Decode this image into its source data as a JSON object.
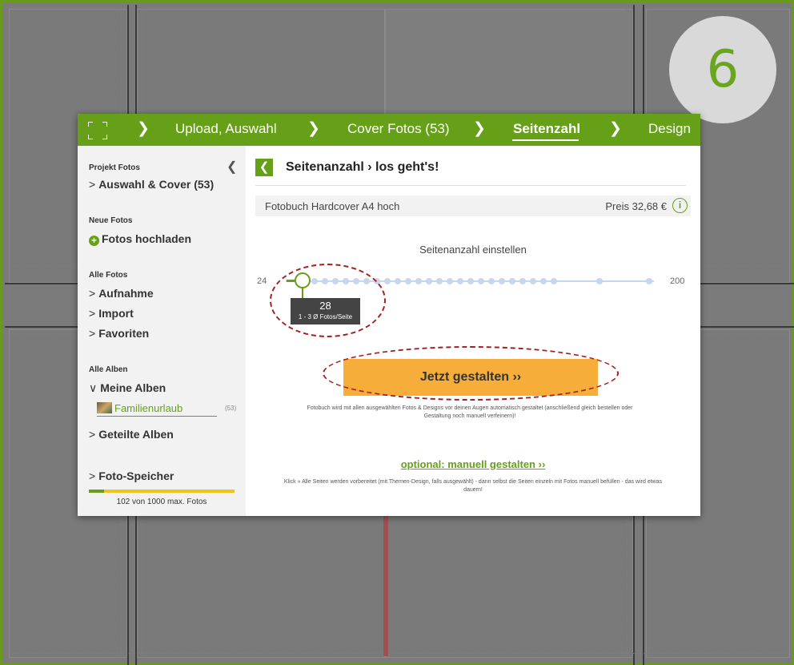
{
  "step_badge": "6",
  "nav": {
    "items": [
      "Upload, Auswahl",
      "Cover Fotos (53)",
      "Seitenzahl",
      "Design"
    ],
    "active": "Seitenzahl"
  },
  "sidebar": {
    "projekt_fotos": "Projekt Fotos",
    "auswahl_cover": "Auswahl & Cover (53)",
    "neue_fotos": "Neue Fotos",
    "fotos_hochladen": "Fotos hochladen",
    "alle_fotos": "Alle Fotos",
    "aufnahme": "Aufnahme",
    "import": "Import",
    "favoriten": "Favoriten",
    "alle_alben": "Alle Alben",
    "meine_alben": "Meine Alben",
    "album_name": "Familienurlaub",
    "album_count": "(53)",
    "geteilte_alben": "Geteilte Alben",
    "foto_speicher": "Foto-Speicher",
    "storage_used": 102,
    "storage_max": 1000,
    "storage_text": "102 von 1000 max. Fotos"
  },
  "main": {
    "title": "Seitenanzahl › los geht's!",
    "product": "Fotobuch Hardcover A4 hoch",
    "price": "Preis 32,68 €",
    "info_icon": "i",
    "slider_label": "Seitenanzahl einstellen",
    "slider_min": "24",
    "slider_max": "200",
    "slider_value": "28",
    "slider_sub": "1 - 3 Ø Fotos/Seite",
    "cta": "Jetzt gestalten ››",
    "cta_desc": "Fotobuch wird mit allen ausgewählten Fotos & Designs vor deinen Augen automatisch gestaltet (anschließend gleich bestellen oder Gestaltung noch manuell verfeinern)!",
    "manual_link": "optional: manuell gestalten ››",
    "manual_desc": "Klick » Alle Seiten werden vorbereitet (mit Themen-Design, falls ausgewählt) - dann selbst die Seiten einzeln mit Fotos manuell befüllen - das wird etwas dauern!"
  },
  "colors": {
    "accent": "#66a019",
    "cta": "#f6ad39",
    "annotation": "#a51f1f"
  }
}
